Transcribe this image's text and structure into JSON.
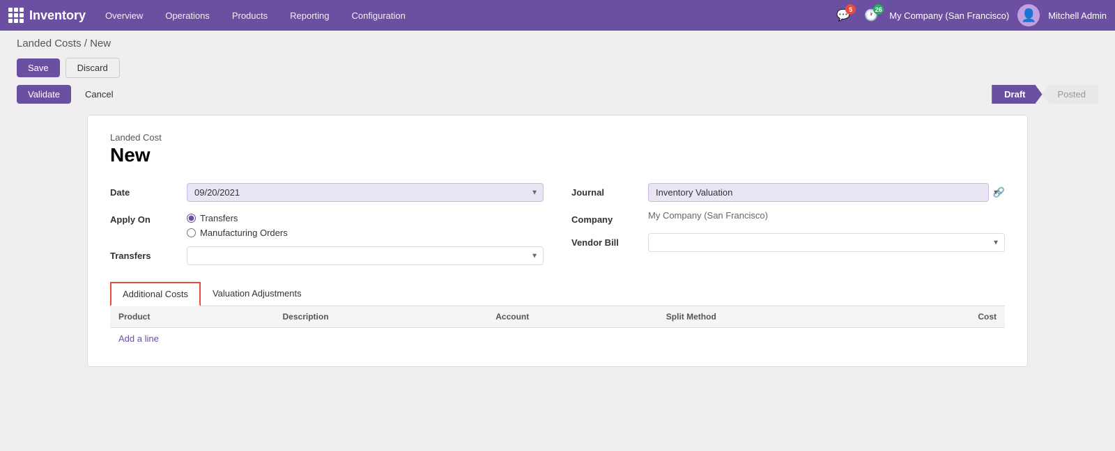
{
  "topnav": {
    "app_name": "Inventory",
    "menu_items": [
      "Overview",
      "Operations",
      "Products",
      "Reporting",
      "Configuration"
    ],
    "notifications": [
      {
        "count": "5",
        "type": "message"
      },
      {
        "count": "26",
        "type": "activity"
      }
    ],
    "company": "My Company (San Francisco)",
    "user": "Mitchell Admin"
  },
  "breadcrumb": {
    "text": "Landed Costs / New"
  },
  "actions": {
    "save": "Save",
    "discard": "Discard",
    "validate": "Validate",
    "cancel": "Cancel",
    "status_draft": "Draft",
    "status_posted": "Posted"
  },
  "form": {
    "subtitle": "Landed Cost",
    "title": "New",
    "date_label": "Date",
    "date_value": "09/20/2021",
    "apply_on_label": "Apply On",
    "radio_transfers": "Transfers",
    "radio_manufacturing": "Manufacturing Orders",
    "transfers_label": "Transfers",
    "journal_label": "Journal",
    "journal_value": "Inventory Valuation",
    "company_label": "Company",
    "company_value": "My Company (San Francisco)",
    "vendor_bill_label": "Vendor Bill",
    "vendor_bill_value": ""
  },
  "tabs": [
    {
      "id": "additional-costs",
      "label": "Additional Costs",
      "active": true
    },
    {
      "id": "valuation-adjustments",
      "label": "Valuation Adjustments",
      "active": false
    }
  ],
  "table": {
    "columns": [
      "Product",
      "Description",
      "Account",
      "Split Method",
      "Cost"
    ],
    "rows": [],
    "add_line": "Add a line"
  }
}
